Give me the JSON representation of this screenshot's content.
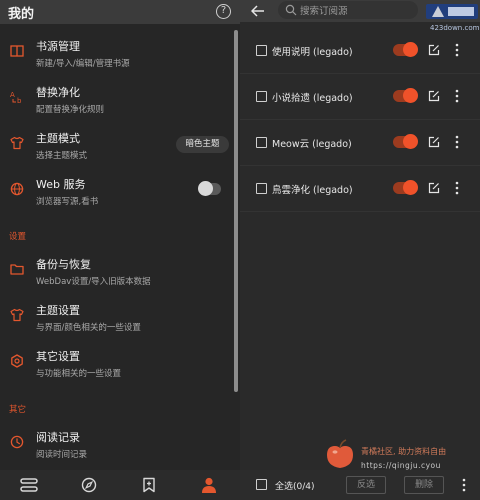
{
  "left": {
    "title": "我的",
    "help_icon": "?",
    "menu": [
      {
        "icon": "book-icon",
        "title": "书源管理",
        "subtitle": "新建/导入/编辑/管理书源"
      },
      {
        "icon": "replace-icon",
        "title": "替换净化",
        "subtitle": "配置替换净化规则"
      },
      {
        "icon": "shirt-icon",
        "title": "主题模式",
        "subtitle": "选择主题模式",
        "chip": "暗色主题"
      },
      {
        "icon": "globe-icon",
        "title": "Web 服务",
        "subtitle": "浏览器写源,看书",
        "toggle": false
      }
    ],
    "section_settings": "设置",
    "settings": [
      {
        "icon": "folder-icon",
        "title": "备份与恢复",
        "subtitle": "WebDav设置/导入旧版本数据"
      },
      {
        "icon": "shirt-icon",
        "title": "主题设置",
        "subtitle": "与界面/颜色相关的一些设置"
      },
      {
        "icon": "settings-icon",
        "title": "其它设置",
        "subtitle": "与功能相关的一些设置"
      }
    ],
    "section_other": "其它",
    "other": [
      {
        "icon": "clock-icon",
        "title": "阅读记录",
        "subtitle": "阅读时间记录"
      }
    ],
    "bottom_nav": [
      "bookshelf-icon",
      "compass-icon",
      "bookmark-add-icon",
      "person-icon"
    ]
  },
  "right": {
    "search_placeholder": "搜索订阅源",
    "watermark_url": "423down.com",
    "rows": [
      {
        "label": "使用说明 (legado)",
        "checked": false,
        "enabled": true
      },
      {
        "label": "小说拾遗 (legado)",
        "checked": false,
        "enabled": true
      },
      {
        "label": "Meow云 (legado)",
        "checked": false,
        "enabled": true
      },
      {
        "label": "鳥雲浄化 (legado)",
        "checked": false,
        "enabled": true
      }
    ],
    "footer": {
      "select_all": "全选(0/4)",
      "invert": "反选",
      "delete": "删除"
    },
    "watermark_bottom": {
      "text": "青橘社区, 助力资料自由",
      "url": "https://qingju.cyou"
    }
  },
  "colors": {
    "accent": "#e4572e",
    "toggle_on": "#f0522a",
    "background": "#262626"
  }
}
